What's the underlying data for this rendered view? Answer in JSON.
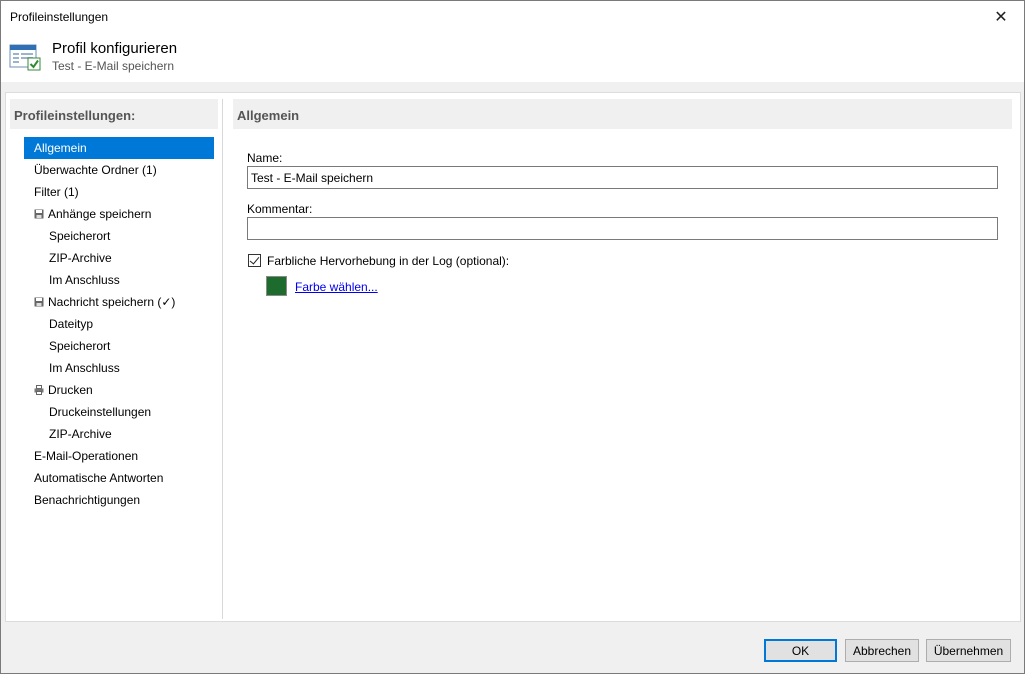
{
  "window": {
    "title": "Profileinstellungen",
    "close_symbol": "✕"
  },
  "header": {
    "title": "Profil konfigurieren",
    "subtitle": "Test - E-Mail speichern",
    "icon": "profile-settings-icon"
  },
  "sidebar": {
    "heading": "Profileinstellungen:",
    "items": [
      {
        "label": "Allgemein",
        "level": 0,
        "active": true
      },
      {
        "label": "Überwachte Ordner (1)",
        "level": 0
      },
      {
        "label": "Filter (1)",
        "level": 0
      },
      {
        "label": "Anhänge speichern",
        "level": 0,
        "icon": "save-icon"
      },
      {
        "label": "Speicherort",
        "level": 1
      },
      {
        "label": "ZIP-Archive",
        "level": 1
      },
      {
        "label": "Im Anschluss",
        "level": 1
      },
      {
        "label": "Nachricht speichern (✓)",
        "level": 0,
        "icon": "save-icon"
      },
      {
        "label": "Dateityp",
        "level": 1
      },
      {
        "label": "Speicherort",
        "level": 1
      },
      {
        "label": "Im Anschluss",
        "level": 1
      },
      {
        "label": "Drucken",
        "level": 0,
        "icon": "printer-icon"
      },
      {
        "label": "Druckeinstellungen",
        "level": 1
      },
      {
        "label": "ZIP-Archive",
        "level": 1
      },
      {
        "label": "E-Mail-Operationen",
        "level": 0
      },
      {
        "label": "Automatische Antworten",
        "level": 0
      },
      {
        "label": "Benachrichtigungen",
        "level": 0
      }
    ]
  },
  "content": {
    "heading": "Allgemein",
    "name_label": "Name:",
    "name_value": "Test - E-Mail speichern",
    "comment_label": "Kommentar:",
    "comment_value": "",
    "highlight_checkbox_label": "Farbliche Hervorhebung in der Log (optional):",
    "highlight_checked": true,
    "highlight_color": "#1e6b2e",
    "choose_color_link": "Farbe wählen..."
  },
  "buttons": {
    "ok": "OK",
    "cancel": "Abbrechen",
    "apply": "Übernehmen"
  },
  "colors": {
    "accent": "#0078d7",
    "selected_color": "#1e6b2e"
  }
}
